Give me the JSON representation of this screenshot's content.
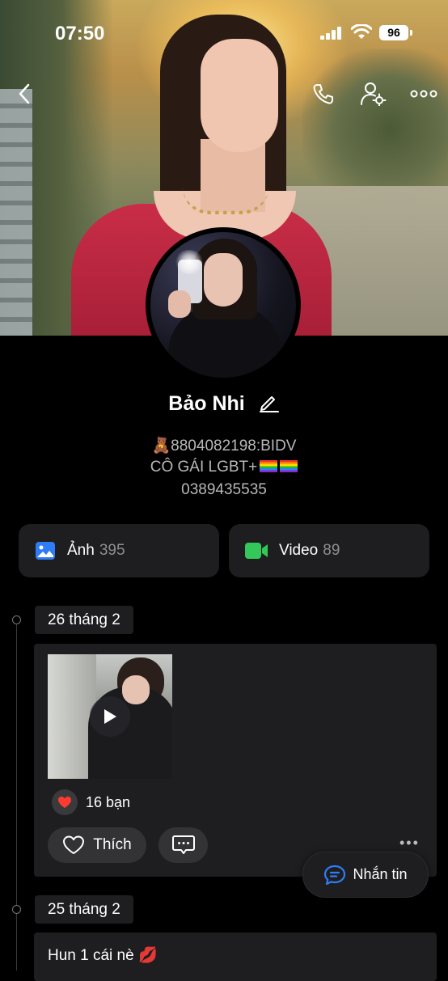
{
  "status_bar": {
    "time": "07:50",
    "battery": "96"
  },
  "profile": {
    "name": "Bảo Nhi",
    "bio_line1": "🧸8804082198:BIDV",
    "bio_line2": "CÔ GÁI LGBT+",
    "bio_line3": "0389435535"
  },
  "media_tiles": [
    {
      "label": "Ảnh",
      "count": "395",
      "icon": "photo-icon",
      "color": "#2f7cf6"
    },
    {
      "label": "Video",
      "count": "89",
      "icon": "video-icon",
      "color": "#34c759"
    }
  ],
  "timeline": [
    {
      "date": "26 tháng 2",
      "reaction_text": "16 bạn",
      "like_label": "Thích",
      "more_icon": "more-dots-icon"
    },
    {
      "date": "25 tháng 2",
      "text": "Hun 1 cái nè 💋"
    }
  ],
  "message_button": {
    "label": "Nhắn tin"
  },
  "colors": {
    "accent": "#2f7cf6",
    "like_red": "#ff3b30",
    "card_bg": "#1e1e20"
  }
}
